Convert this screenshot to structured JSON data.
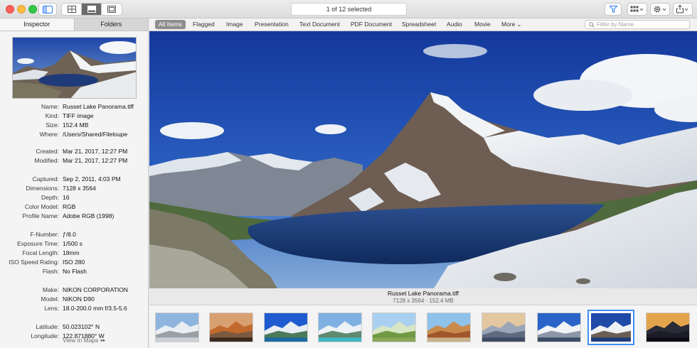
{
  "toolbar": {
    "status": "1 of 12 selected",
    "icons": [
      "sidebar-toggle-icon",
      "grid-view-icon",
      "browser-view-icon",
      "fullscreen-view-icon",
      "filter-icon",
      "arrange-icon",
      "action-gear-icon",
      "share-icon"
    ]
  },
  "sidebar": {
    "tabs": [
      "Inspector",
      "Folders"
    ],
    "active_tab": "Inspector",
    "info": [
      {
        "label": "Name:",
        "value": "Russet Lake Panorama.tiff"
      },
      {
        "label": "Kind:",
        "value": "TIFF image"
      },
      {
        "label": "Size:",
        "value": "152.4 MB"
      },
      {
        "label": "Where:",
        "value": "/Users/Shared/Fileloupe"
      },
      {
        "label": "Created:",
        "value": "Mar 21, 2017, 12:27 PM"
      },
      {
        "label": "Modified:",
        "value": "Mar 21, 2017, 12:27 PM"
      },
      {
        "label": "Captured:",
        "value": "Sep 2, 2011, 4:03 PM"
      },
      {
        "label": "Dimensions:",
        "value": "7128 x 3564"
      },
      {
        "label": "Depth:",
        "value": "16"
      },
      {
        "label": "Color Model:",
        "value": "RGB"
      },
      {
        "label": "Profile Name:",
        "value": "Adobe RGB (1998)"
      },
      {
        "label": "F-Number:",
        "value": "ƒ/8.0"
      },
      {
        "label": "Exposure Time:",
        "value": "1/500 s"
      },
      {
        "label": "Focal Length:",
        "value": "18mm"
      },
      {
        "label": "ISO Speed Rating:",
        "value": "ISO 280"
      },
      {
        "label": "Flash:",
        "value": "No Flash"
      },
      {
        "label": "Make:",
        "value": "NIKON CORPORATION"
      },
      {
        "label": "Model:",
        "value": "NIKON D90"
      },
      {
        "label": "Lens:",
        "value": "18.0-200.0 mm f/3.5-5.6"
      },
      {
        "label": "Latitude:",
        "value": "50.023102° N"
      },
      {
        "label": "Longitude:",
        "value": "122.871880° W"
      }
    ],
    "maps_link": "View in Maps ➡"
  },
  "filters": {
    "items": [
      "All Items",
      "Flagged",
      "Image",
      "Presentation",
      "Text Document",
      "PDF Document",
      "Spreadsheet",
      "Audio",
      "Movie",
      "More"
    ],
    "active": "All Items",
    "search_placeholder": "Filter by Name"
  },
  "viewer": {
    "title": "Russet Lake Panorama.tiff",
    "subtitle": "7128 x 3564  ·  152.4 MB"
  },
  "filmstrip": {
    "count": 10,
    "selected_index": 8
  }
}
